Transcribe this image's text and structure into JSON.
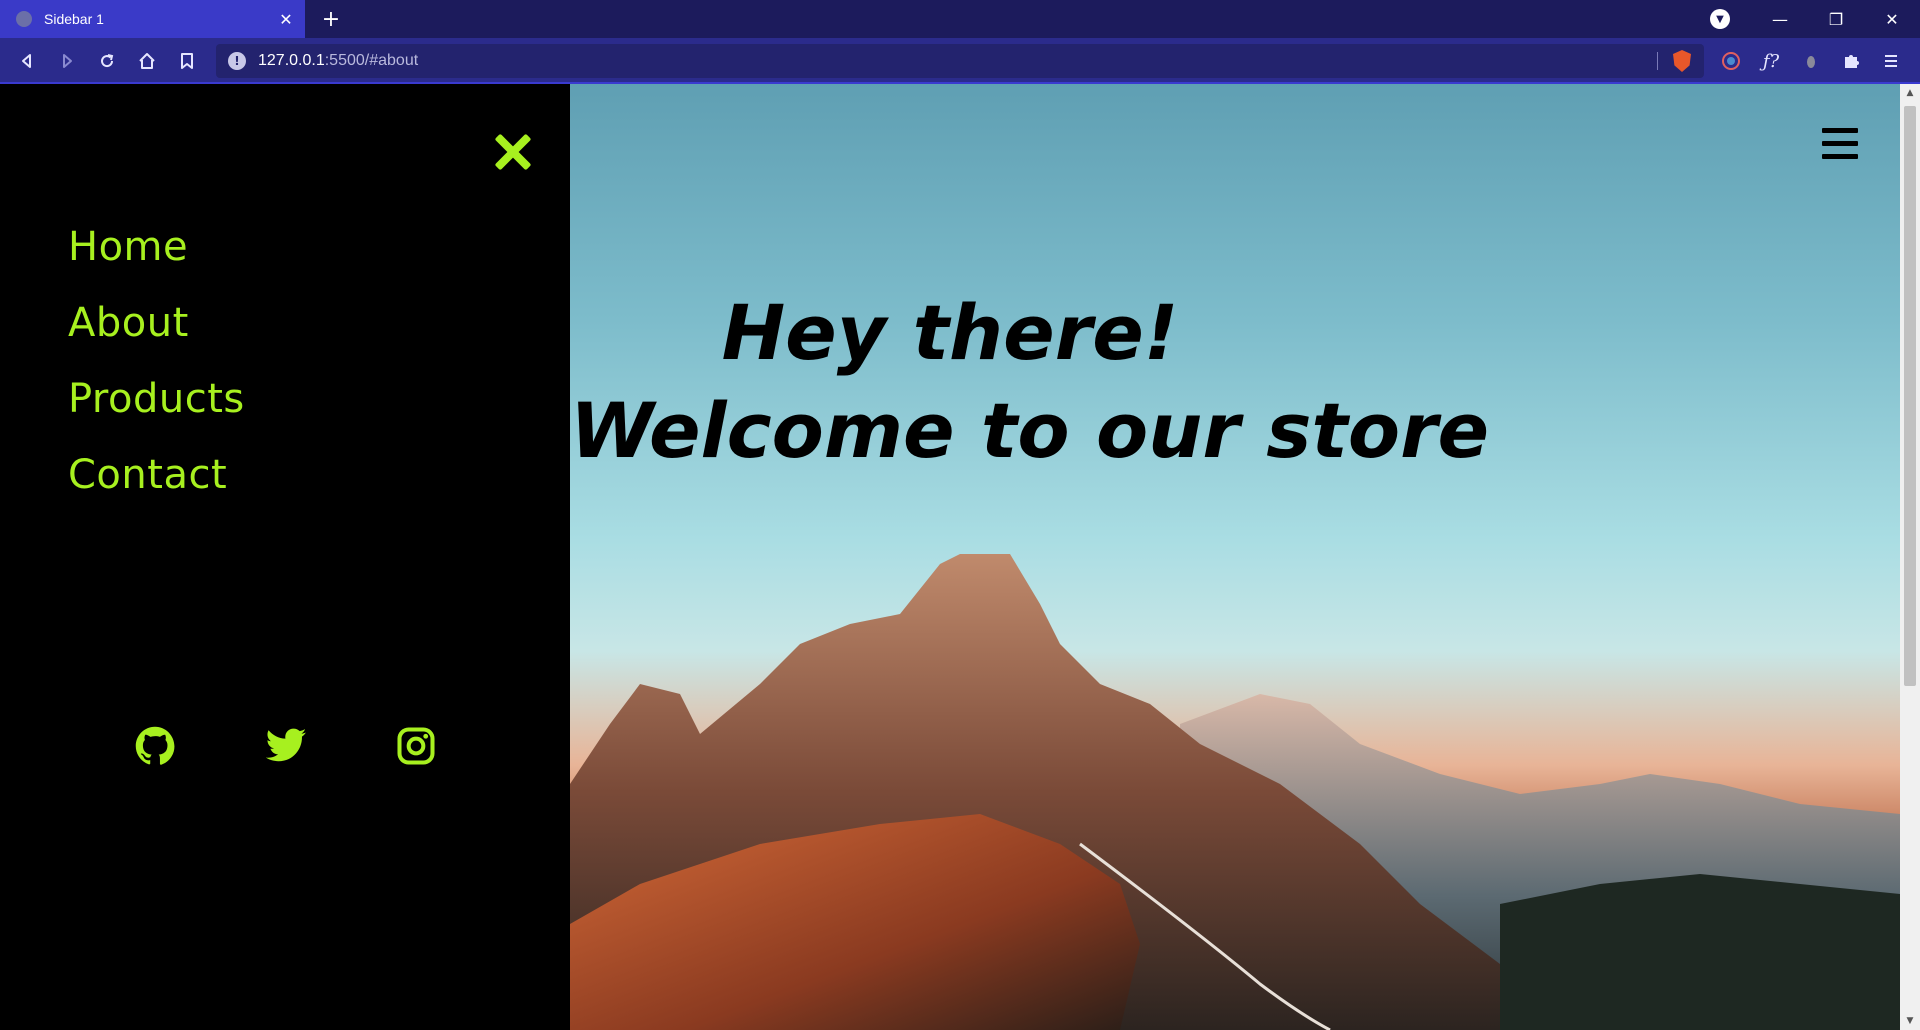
{
  "browser": {
    "tab_title": "Sidebar 1",
    "tab_close": "✕",
    "new_tab": "+",
    "url_host": "127.0.0.1",
    "url_path": ":5500/#about",
    "window_controls": [
      "—",
      "❐",
      "✕"
    ]
  },
  "toolbar_icons": [
    "back-icon",
    "forward-icon",
    "reload-icon",
    "home-icon",
    "bookmark-icon"
  ],
  "sidebar": {
    "nav": [
      {
        "label": "Home"
      },
      {
        "label": "About"
      },
      {
        "label": "Products"
      },
      {
        "label": "Contact"
      }
    ],
    "social_icons": [
      "github-icon",
      "twitter-icon",
      "instagram-icon"
    ],
    "accent_color": "#a7f01f"
  },
  "hero": {
    "line1": "Hey there!",
    "line2": "Welcome to our store"
  }
}
